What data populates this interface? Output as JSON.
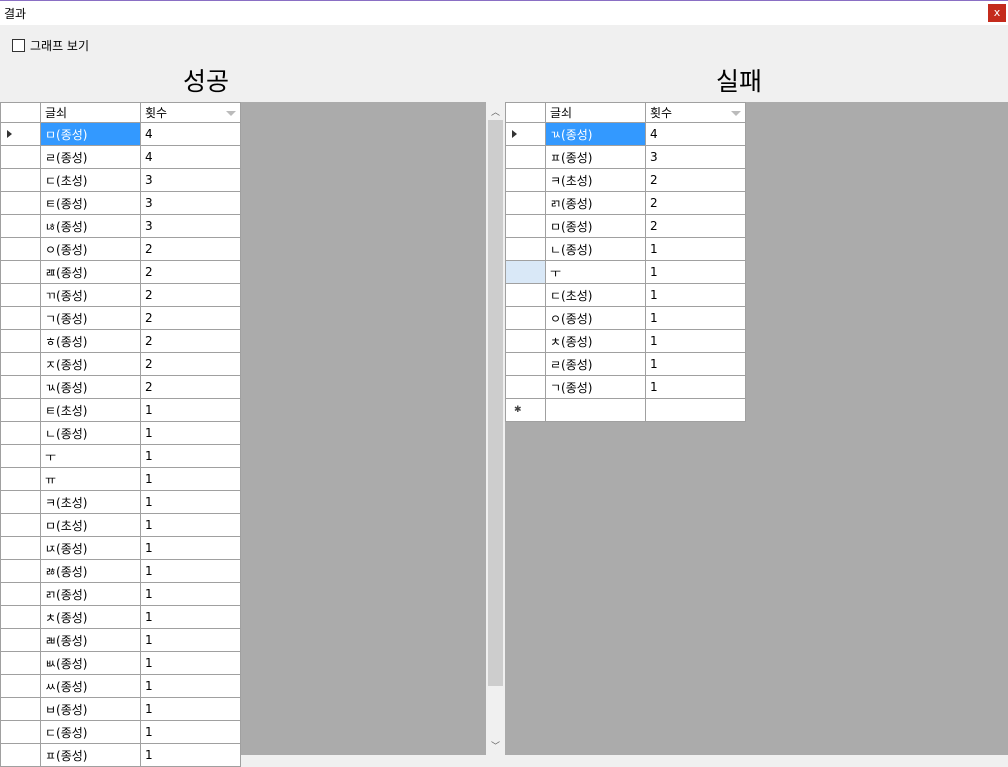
{
  "window": {
    "title": "결과",
    "close": "x"
  },
  "graph_checkbox": {
    "label": "그래프 보기",
    "checked": false
  },
  "success": {
    "title": "성공",
    "columns": [
      "글쇠",
      "횟수"
    ],
    "rows": [
      [
        "ㅁ(종성)",
        "4"
      ],
      [
        "ㄹ(종성)",
        "4"
      ],
      [
        "ㄷ(초성)",
        "3"
      ],
      [
        "ㅌ(종성)",
        "3"
      ],
      [
        "ㄶ(종성)",
        "3"
      ],
      [
        "ㅇ(종성)",
        "2"
      ],
      [
        "ㄿ(종성)",
        "2"
      ],
      [
        "ㄲ(종성)",
        "2"
      ],
      [
        "ㄱ(종성)",
        "2"
      ],
      [
        "ㅎ(종성)",
        "2"
      ],
      [
        "ㅈ(종성)",
        "2"
      ],
      [
        "ㄳ(종성)",
        "2"
      ],
      [
        "ㅌ(초성)",
        "1"
      ],
      [
        "ㄴ(종성)",
        "1"
      ],
      [
        "ㅜ",
        "1"
      ],
      [
        "ㅠ",
        "1"
      ],
      [
        "ㅋ(초성)",
        "1"
      ],
      [
        "ㅁ(초성)",
        "1"
      ],
      [
        "ㄵ(종성)",
        "1"
      ],
      [
        "ㅀ(종성)",
        "1"
      ],
      [
        "ㄺ(종성)",
        "1"
      ],
      [
        "ㅊ(종성)",
        "1"
      ],
      [
        "ㄼ(종성)",
        "1"
      ],
      [
        "ㅄ(종성)",
        "1"
      ],
      [
        "ㅆ(종성)",
        "1"
      ],
      [
        "ㅂ(종성)",
        "1"
      ],
      [
        "ㄷ(종성)",
        "1"
      ],
      [
        "ㅍ(종성)",
        "1"
      ]
    ]
  },
  "failure": {
    "title": "실패",
    "columns": [
      "글쇠",
      "횟수"
    ],
    "rows": [
      [
        "ㄳ(종성)",
        "4"
      ],
      [
        "ㅍ(종성)",
        "3"
      ],
      [
        "ㅋ(초성)",
        "2"
      ],
      [
        "ㄺ(종성)",
        "2"
      ],
      [
        "ㅁ(종성)",
        "2"
      ],
      [
        "ㄴ(종성)",
        "1"
      ],
      [
        "ㅜ",
        "1"
      ],
      [
        "ㄷ(초성)",
        "1"
      ],
      [
        "ㅇ(종성)",
        "1"
      ],
      [
        "ㅊ(종성)",
        "1"
      ],
      [
        "ㄹ(종성)",
        "1"
      ],
      [
        "ㄱ(종성)",
        "1"
      ]
    ]
  }
}
